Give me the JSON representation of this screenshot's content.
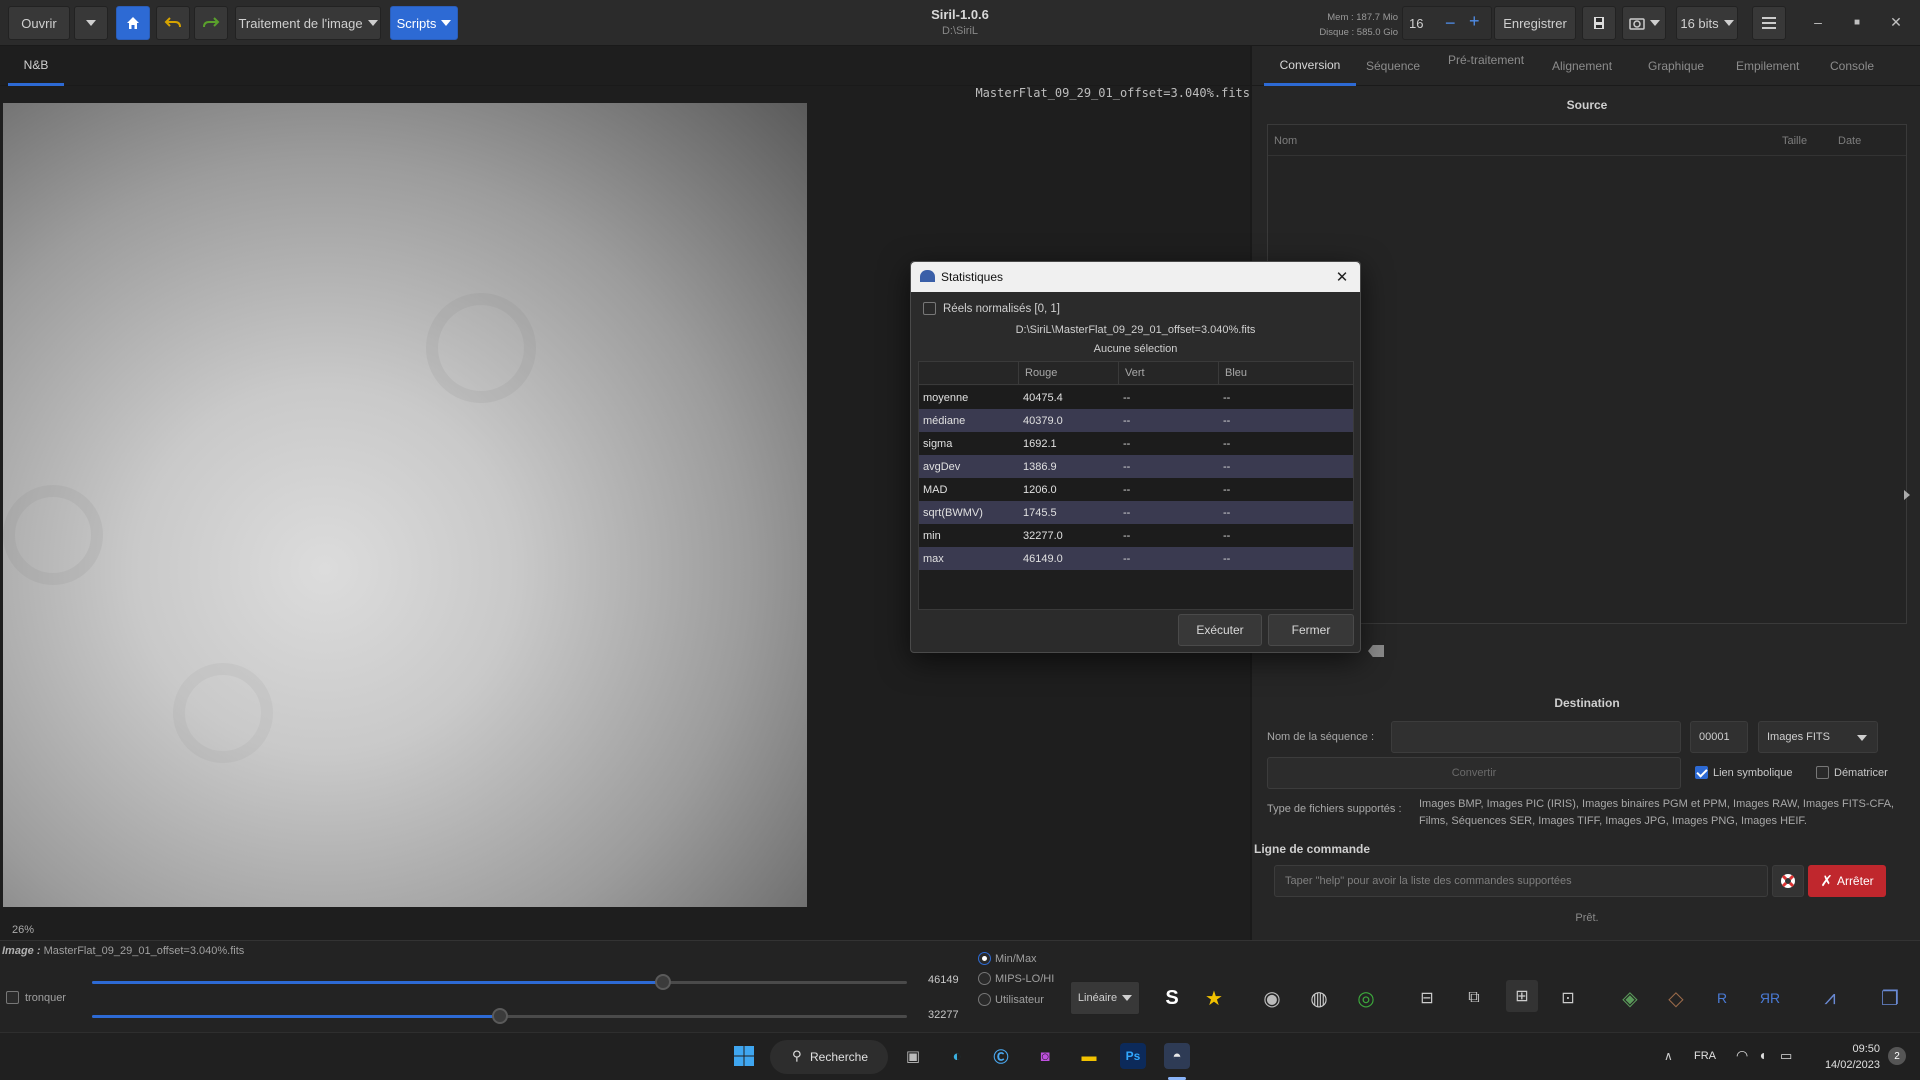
{
  "header": {
    "open_label": "Ouvrir",
    "image_processing_label": "Traitement de l'image",
    "scripts_label": "Scripts",
    "app_title": "Siril-1.0.6",
    "app_path": "D:\\SiriL",
    "memory": "Mem : 187.7 Mio",
    "disk": "Disque : 585.0 Gio",
    "threads_value": "16",
    "save_label": "Enregistrer",
    "bitdepth_label": "16 bits"
  },
  "left": {
    "tab_label": "N&B",
    "filename": "MasterFlat_09_29_01_offset=3.040%.fits",
    "zoom": "26%"
  },
  "right": {
    "tabs": [
      "Conversion",
      "Séquence",
      "Pré-traitement",
      "Alignement",
      "Graphique",
      "Empilement",
      "Console"
    ],
    "source_title": "Source",
    "source_columns": [
      "Nom",
      "Taille",
      "Date"
    ],
    "dest_title": "Destination",
    "seq_name_label": "Nom de la séquence :",
    "seq_number": "00001",
    "format_select": "Images FITS",
    "convert_label": "Convertir",
    "symlink_label": "Lien symbolique",
    "debayer_label": "Dématricer",
    "types_label": "Type de fichiers supportés :",
    "types_text": "Images BMP, Images PIC (IRIS), Images binaires PGM et PPM, Images RAW, Images FITS-CFA, Films, Séquences SER, Images TIFF, Images JPG, Images PNG, Images HEIF.",
    "cmd_title": "Ligne de commande",
    "cmd_placeholder": "Taper \"help\" pour avoir la liste des commandes supportées",
    "stop_label": "Arrêter",
    "status": "Prêt."
  },
  "bottom": {
    "image_prefix": "Image :",
    "image_name": "MasterFlat_09_29_01_offset=3.040%.fits",
    "truncate_label": "tronquer",
    "high_value": "46149",
    "low_value": "32277",
    "high_slider_fraction": 0.7,
    "low_slider_fraction": 0.5,
    "modes": [
      "Min/Max",
      "MIPS-LO/HI",
      "Utilisateur"
    ],
    "scale_select": "Linéaire"
  },
  "dialog": {
    "title": "Statistiques",
    "normalized_label": "Réels normalisés [0, 1]",
    "file": "D:\\SiriL\\MasterFlat_09_29_01_offset=3.040%.fits",
    "selection": "Aucune sélection",
    "columns": [
      "",
      "Rouge",
      "Vert",
      "Bleu"
    ],
    "rows": [
      [
        "moyenne",
        "40475.4",
        "--",
        "--"
      ],
      [
        "médiane",
        "40379.0",
        "--",
        "--"
      ],
      [
        "sigma",
        "1692.1",
        "--",
        "--"
      ],
      [
        "avgDev",
        "1386.9",
        "--",
        "--"
      ],
      [
        "MAD",
        "1206.0",
        "--",
        "--"
      ],
      [
        "sqrt(BWMV)",
        "1745.5",
        "--",
        "--"
      ],
      [
        "min",
        "32277.0",
        "--",
        "--"
      ],
      [
        "max",
        "46149.0",
        "--",
        "--"
      ]
    ],
    "execute_label": "Exécuter",
    "close_label": "Fermer"
  },
  "taskbar": {
    "search_label": "Recherche",
    "language": "FRA",
    "time": "09:50",
    "date": "14/02/2023",
    "notification_count": "2"
  },
  "colors": {
    "accent": "#2d6ad4",
    "stop_red": "#c0272d",
    "row_alt": "#3a3a50"
  }
}
